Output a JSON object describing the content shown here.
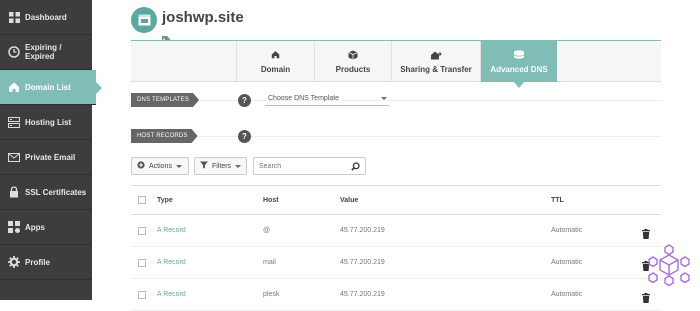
{
  "sidebar": {
    "items": [
      {
        "label": "Dashboard",
        "icon": "dashboard-icon"
      },
      {
        "label": "Expiring / Expired",
        "icon": "clock-icon"
      },
      {
        "label": "Domain List",
        "icon": "home-icon",
        "active": true
      },
      {
        "label": "Hosting List",
        "icon": "server-icon"
      },
      {
        "label": "Private Email",
        "icon": "envelope-icon"
      },
      {
        "label": "SSL Certificates",
        "icon": "lock-icon"
      },
      {
        "label": "Apps",
        "icon": "apps-icon"
      },
      {
        "label": "Profile",
        "icon": "gear-icon"
      }
    ]
  },
  "header": {
    "title": "joshwp.site"
  },
  "tabs": [
    {
      "label": "Domain",
      "icon": "home-icon"
    },
    {
      "label": "Products",
      "icon": "box-icon"
    },
    {
      "label": "Sharing & Transfer",
      "icon": "transfer-icon"
    },
    {
      "label": "Advanced DNS",
      "icon": "dns-icon",
      "active": true
    }
  ],
  "dns_templates": {
    "label": "DNS TEMPLATES",
    "select_value": "Choose DNS Template"
  },
  "host_records": {
    "label": "HOST RECORDS"
  },
  "help_glyph": "?",
  "toolbar": {
    "actions_label": "Actions",
    "filters_label": "Filters",
    "search_placeholder": "Search"
  },
  "table": {
    "columns": {
      "type": "Type",
      "host": "Host",
      "value": "Value",
      "ttl": "TTL"
    },
    "rows": [
      {
        "type": "A Record",
        "host": "@",
        "value": "45.77.200.219",
        "ttl": "Automatic"
      },
      {
        "type": "A Record",
        "host": "mail",
        "value": "45.77.200.219",
        "ttl": "Automatic"
      },
      {
        "type": "A Record",
        "host": "plesk",
        "value": "45.77.200.219",
        "ttl": "Automatic"
      }
    ]
  },
  "colors": {
    "accent": "#7fbdb6",
    "sidebar_bg": "#3d3d3d",
    "link": "#6aa9a3"
  }
}
